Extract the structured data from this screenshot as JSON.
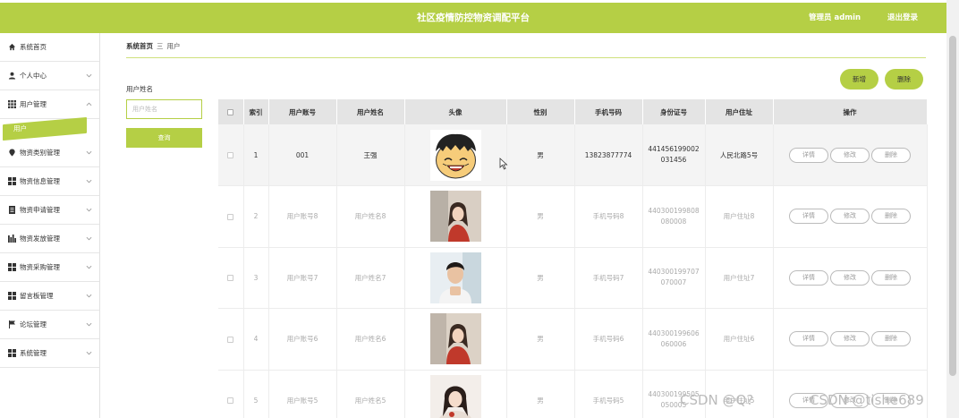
{
  "header": {
    "title": "社区疫情防控物资调配平台",
    "admin_label": "管理员 admin",
    "logout_label": "退出登录"
  },
  "sidebar": {
    "items": [
      {
        "label": "系统首页",
        "icon": "home-icon",
        "expandable": false
      },
      {
        "label": "个人中心",
        "icon": "user-icon",
        "expandable": true
      },
      {
        "label": "用户管理",
        "icon": "grid-icon",
        "expandable": true,
        "expanded": true
      },
      {
        "label": "物资类别管理",
        "icon": "pin-icon",
        "expandable": true
      },
      {
        "label": "物资信息管理",
        "icon": "apps-icon",
        "expandable": true
      },
      {
        "label": "物资申请管理",
        "icon": "document-icon",
        "expandable": true
      },
      {
        "label": "物资发放管理",
        "icon": "bar-chart-icon",
        "expandable": true
      },
      {
        "label": "物资采购管理",
        "icon": "apps-icon",
        "expandable": true
      },
      {
        "label": "留言板管理",
        "icon": "apps-icon",
        "expandable": true
      },
      {
        "label": "论坛管理",
        "icon": "flag-icon",
        "expandable": true
      },
      {
        "label": "系统管理",
        "icon": "apps-icon",
        "expandable": true
      }
    ],
    "active_sub": "用户"
  },
  "breadcrumb": {
    "home": "系统首页",
    "separator": "三",
    "current": "用户"
  },
  "search": {
    "label": "用户姓名",
    "placeholder": "用户姓名",
    "button": "查询"
  },
  "actions": {
    "add": "新增",
    "delete": "删除"
  },
  "table": {
    "headers": [
      "",
      "索引",
      "用户账号",
      "用户姓名",
      "头像",
      "性别",
      "手机号码",
      "身份证号",
      "用户住址",
      "操作"
    ],
    "rows": [
      {
        "index": "1",
        "account": "001",
        "name": "王强",
        "avatar": "cartoon-avatar-icon",
        "gender": "男",
        "phone": "13823877774",
        "idcard": "441456199002031456",
        "address": "人民北路5号"
      },
      {
        "index": "2",
        "account": "用户账号8",
        "name": "用户姓名8",
        "avatar": "photo-avatar-icon",
        "gender": "男",
        "phone": "手机号码8",
        "idcard": "440300199808080008",
        "address": "用户住址8"
      },
      {
        "index": "3",
        "account": "用户账号7",
        "name": "用户姓名7",
        "avatar": "photo-avatar-icon",
        "gender": "男",
        "phone": "手机号码7",
        "idcard": "440300199707070007",
        "address": "用户住址7"
      },
      {
        "index": "4",
        "account": "用户账号6",
        "name": "用户姓名6",
        "avatar": "photo-avatar-icon",
        "gender": "男",
        "phone": "手机号码6",
        "idcard": "440300199606060006",
        "address": "用户住址6"
      },
      {
        "index": "5",
        "account": "用户账号5",
        "name": "用户姓名5",
        "avatar": "photo-avatar-icon",
        "gender": "男",
        "phone": "手机号码5",
        "idcard": "440300199505050005",
        "address": "用户住址5"
      }
    ],
    "row_actions": [
      "详情",
      "修改",
      "删除"
    ]
  },
  "watermark": {
    "text1": "CSDN @Q?",
    "text2": "CSDN @tishe689"
  },
  "colors": {
    "accent": "#b5cf45",
    "header_bg": "#e4e4e4"
  }
}
